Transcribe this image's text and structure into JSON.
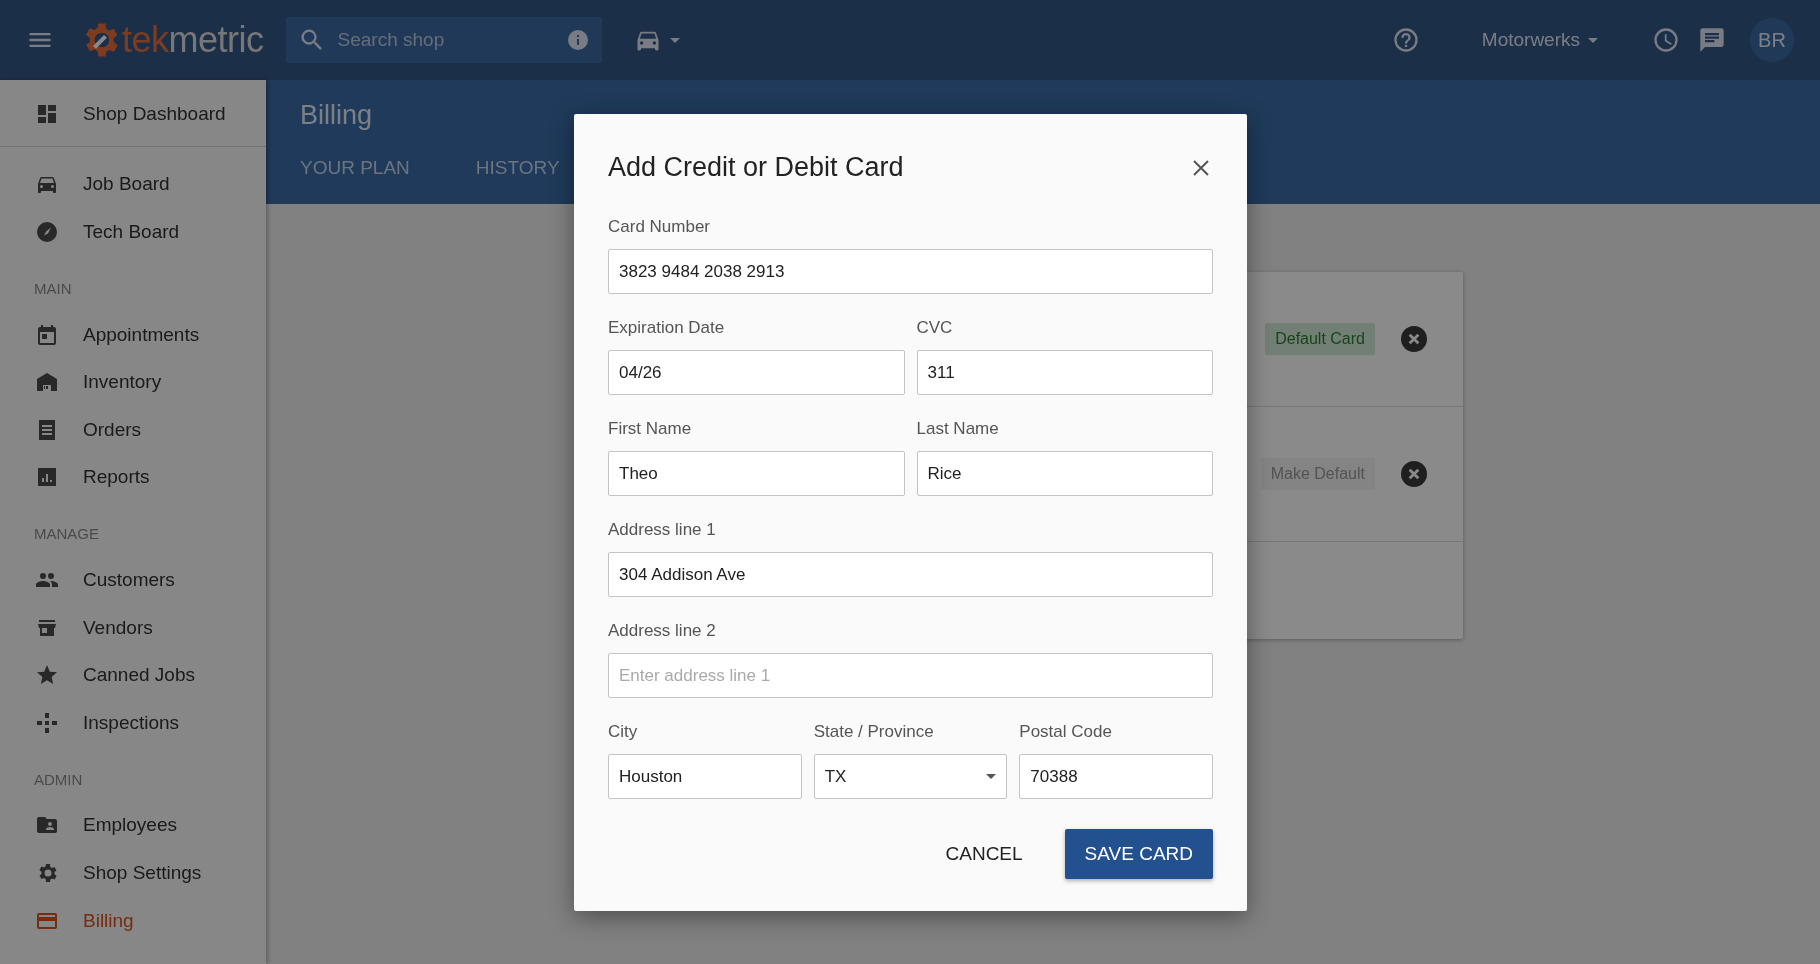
{
  "topbar": {
    "logo": {
      "accent": "tek",
      "rest": "metric"
    },
    "search": {
      "placeholder": "Search shop"
    },
    "shop": "Motorwerks",
    "avatar": "BR"
  },
  "sidebar": {
    "top_items": [
      {
        "label": "Shop Dashboard",
        "selected": false
      }
    ],
    "items": [
      {
        "label": "Job Board",
        "selected": false
      },
      {
        "label": "Tech Board",
        "selected": false
      }
    ],
    "sections": [
      {
        "heading": "MAIN",
        "items": [
          {
            "label": "Appointments",
            "selected": false
          },
          {
            "label": "Inventory",
            "selected": false
          },
          {
            "label": "Orders",
            "selected": false
          },
          {
            "label": "Reports",
            "selected": false
          }
        ]
      },
      {
        "heading": "MANAGE",
        "items": [
          {
            "label": "Customers",
            "selected": false
          },
          {
            "label": "Vendors",
            "selected": false
          },
          {
            "label": "Canned Jobs",
            "selected": false
          },
          {
            "label": "Inspections",
            "selected": false
          }
        ]
      },
      {
        "heading": "ADMIN",
        "items": [
          {
            "label": "Employees",
            "selected": false
          },
          {
            "label": "Shop Settings",
            "selected": false
          },
          {
            "label": "Billing",
            "selected": true
          }
        ]
      }
    ]
  },
  "page": {
    "title": "Billing",
    "tabs": [
      {
        "label": "YOUR PLAN",
        "selected": false
      },
      {
        "label": "HISTORY",
        "selected": false
      }
    ],
    "cards": [
      {
        "kind": "default",
        "badge": "Default Card"
      },
      {
        "kind": "action",
        "badge": "Make Default"
      },
      {
        "kind": "empty"
      }
    ]
  },
  "modal": {
    "title": "Add Credit or Debit Card",
    "rows": [
      [
        {
          "label": "Card Number",
          "kind": "text",
          "value": "3823 9484 2038 2913"
        }
      ],
      [
        {
          "label": "Expiration Date",
          "kind": "text",
          "value": "04/26"
        },
        {
          "label": "CVC",
          "kind": "text",
          "value": "311"
        }
      ],
      [
        {
          "label": "First Name",
          "kind": "text",
          "value": "Theo"
        },
        {
          "label": "Last Name",
          "kind": "text",
          "value": "Rice"
        }
      ],
      [
        {
          "label": "Address line 1",
          "kind": "text",
          "value": "304 Addison Ave"
        }
      ],
      [
        {
          "label": "Address line 2",
          "kind": "text",
          "placeholder": "Enter address line 1"
        }
      ],
      [
        {
          "label": "City",
          "kind": "text",
          "value": "Houston"
        },
        {
          "label": "State / Province",
          "kind": "select",
          "value": "TX"
        },
        {
          "label": "Postal Code",
          "kind": "text",
          "value": "70388"
        }
      ]
    ],
    "buttons": {
      "cancel": "CANCEL",
      "save": "SAVE CARD"
    }
  }
}
